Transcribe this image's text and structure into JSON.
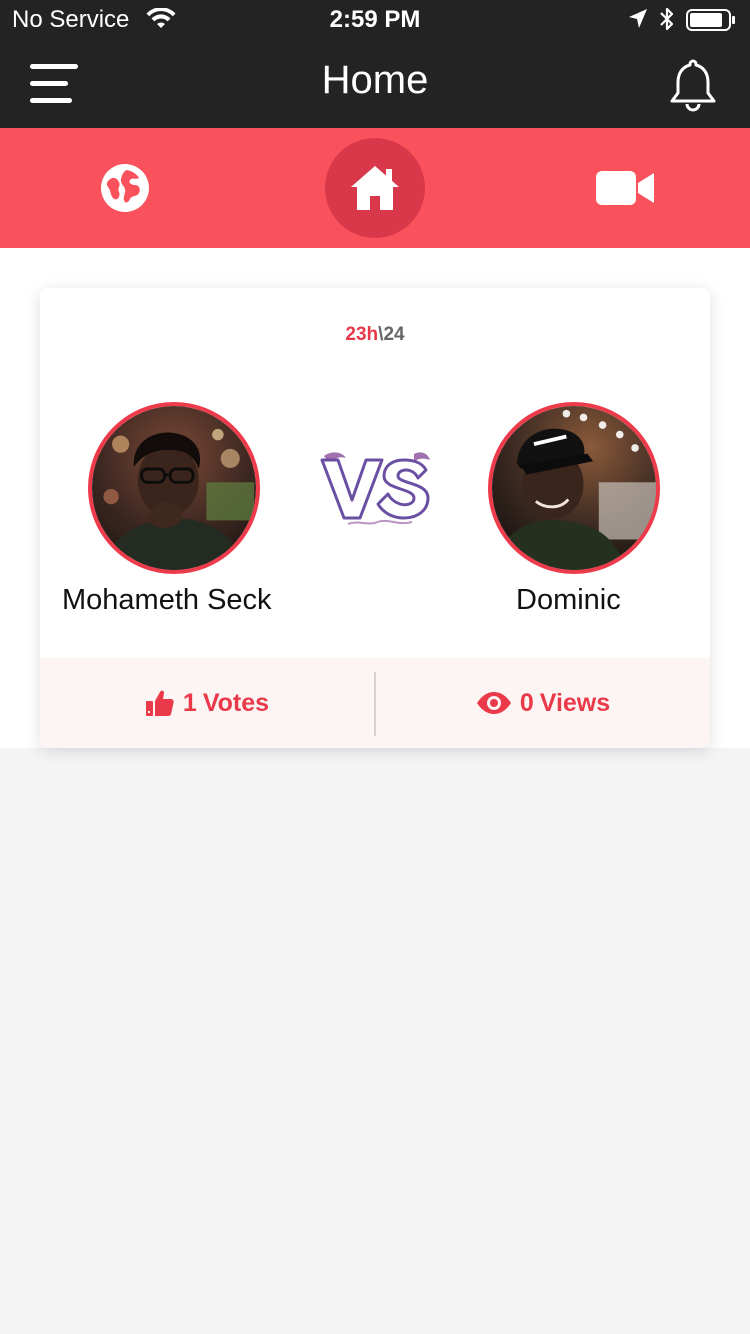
{
  "status_bar": {
    "carrier": "No Service",
    "time": "2:59 PM"
  },
  "nav": {
    "title": "Home"
  },
  "tabs": [
    {
      "icon": "globe-icon",
      "active": false
    },
    {
      "icon": "home-icon",
      "active": true
    },
    {
      "icon": "video-camera-icon",
      "active": false
    }
  ],
  "battle": {
    "timer": {
      "elapsed": "23h",
      "separator": "\\",
      "total": "24"
    },
    "left_player": {
      "name": "Mohameth Seck"
    },
    "right_player": {
      "name": "Dominic"
    },
    "votes": {
      "count": "1",
      "label": "Votes"
    },
    "views": {
      "count": "0",
      "label": "Views"
    }
  },
  "colors": {
    "nav_bg": "#232323",
    "accent": "#f9525d",
    "accent_dark": "#d8384a",
    "stat_red": "#ea3a4a",
    "footer_bg": "#fdf4f4",
    "vs_purple": "#6a4fa3"
  }
}
